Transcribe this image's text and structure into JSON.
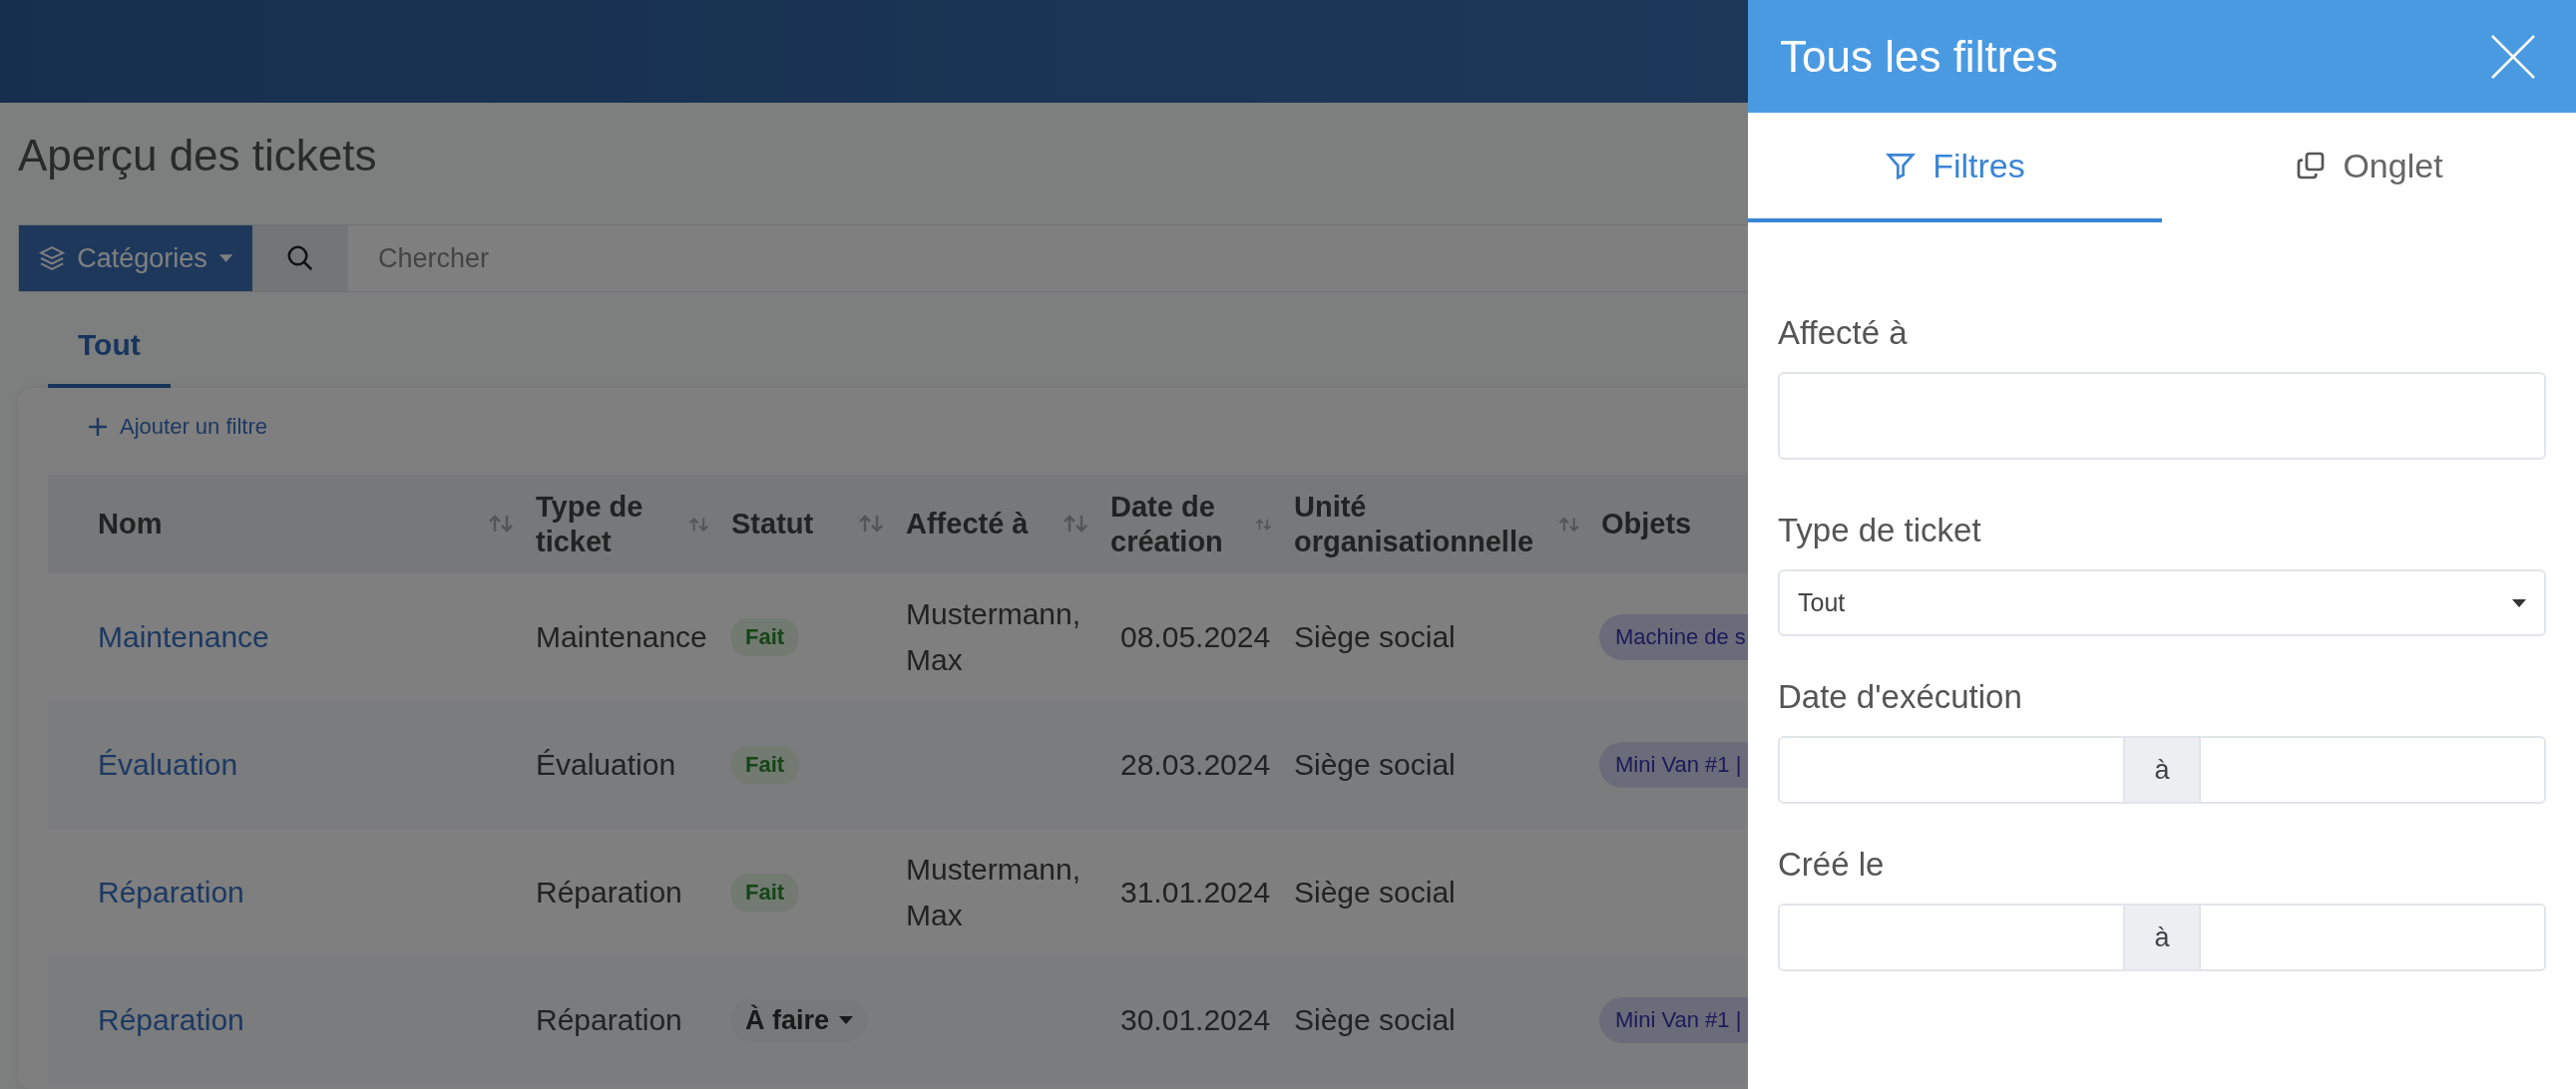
{
  "page": {
    "title": "Aperçu des tickets",
    "categories_button": "Catégories",
    "search": {
      "placeholder": "Chercher"
    },
    "tabs": [
      {
        "label": "Tout",
        "selected": true
      }
    ],
    "add_filter": "Ajouter un filtre"
  },
  "table": {
    "columns": [
      {
        "label": "Nom",
        "sortable": true
      },
      {
        "label": "Type de ticket",
        "sortable": true
      },
      {
        "label": "Statut",
        "sortable": true
      },
      {
        "label": "Affecté à",
        "sortable": true
      },
      {
        "label": "Date de création",
        "sortable": true
      },
      {
        "label": "Unité organisationnelle",
        "sortable": true
      },
      {
        "label": "Objets",
        "sortable": false
      }
    ],
    "rows": [
      {
        "name": "Maintenance",
        "type": "Maintenance",
        "status": {
          "label": "Fait",
          "kind": "badge"
        },
        "assigned": "Mustermann, Max",
        "created": "08.05.2024",
        "unit": "Siège social",
        "object": "Machine de s"
      },
      {
        "name": "Évaluation",
        "type": "Évaluation",
        "status": {
          "label": "Fait",
          "kind": "badge"
        },
        "assigned": "",
        "created": "28.03.2024",
        "unit": "Siège social",
        "object": "Mini Van #1 |"
      },
      {
        "name": "Réparation",
        "type": "Réparation",
        "status": {
          "label": "Fait",
          "kind": "badge"
        },
        "assigned": "Mustermann, Max",
        "created": "31.01.2024",
        "unit": "Siège social",
        "object": ""
      },
      {
        "name": "Réparation",
        "type": "Réparation",
        "status": {
          "label": "À faire",
          "kind": "dropdown"
        },
        "assigned": "",
        "created": "30.01.2024",
        "unit": "Siège social",
        "object": "Mini Van #1 |"
      }
    ]
  },
  "filter_panel": {
    "title": "Tous les filtres",
    "tabs": [
      {
        "label": "Filtres",
        "selected": true
      },
      {
        "label": "Onglet",
        "selected": false
      }
    ],
    "fields": [
      {
        "label": "Affecté à",
        "kind": "text"
      },
      {
        "label": "Type de ticket",
        "kind": "select",
        "value": "Tout"
      },
      {
        "label": "Date d'exécution",
        "kind": "range",
        "separator": "à"
      },
      {
        "label": "Créé le",
        "kind": "range",
        "separator": "à"
      }
    ]
  }
}
